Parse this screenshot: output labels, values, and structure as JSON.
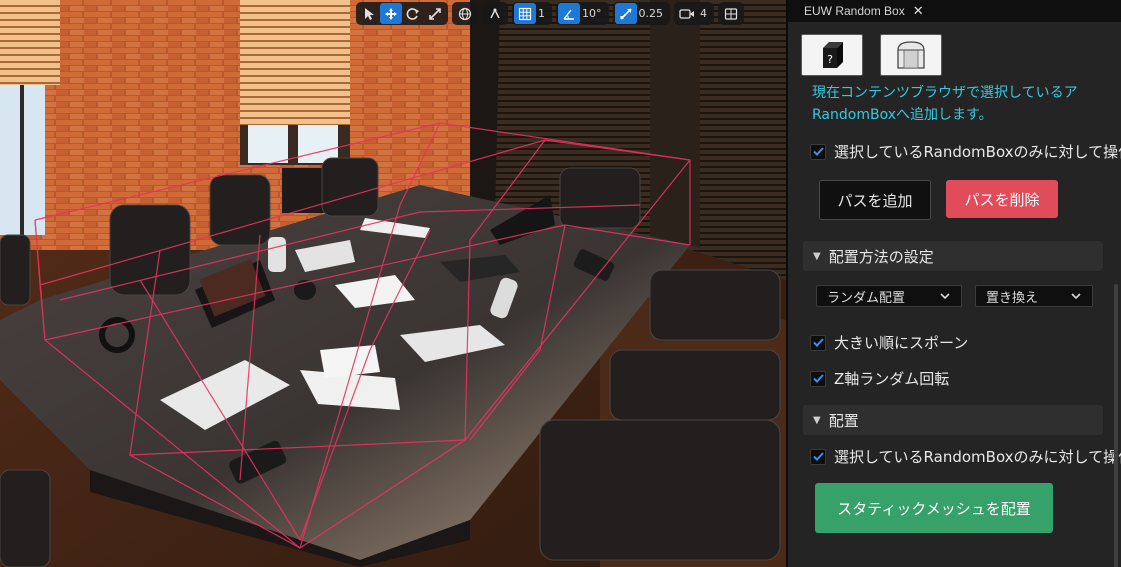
{
  "viewport": {
    "toolbar": {
      "grid_snap_value": "1",
      "rotation_snap_value": "10°",
      "scale_snap_value": "0.25",
      "camera_speed_value": "4"
    }
  },
  "panel": {
    "tab_title": "EUW Random Box",
    "tab_close": "✕",
    "description_line1": "現在コンテンツブラウザで選択しているア",
    "description_line2": "RandomBoxへ追加します。",
    "selected_only_label_1": "選択しているRandomBoxのみに対して操作",
    "add_path_button": "パスを追加",
    "remove_path_button": "パスを削除",
    "placement_method_section": "配置方法の設定",
    "placement_mode_dropdown": "ランダム配置",
    "replace_dropdown": "置き換え",
    "spawn_by_size_label": "大きい順にスポーン",
    "random_z_rotation_label": "Z軸ランダム回転",
    "placement_section": "配置",
    "selected_only_label_2": "選択しているRandomBoxのみに対して操作",
    "place_static_mesh_button": "スタティックメッシュを配置",
    "selected_only_checked": true,
    "spawn_by_size_checked": true,
    "random_z_rotation_checked": true,
    "selected_only_2_checked": true
  },
  "colors": {
    "accent_blue": "#1e78d6",
    "description_cyan": "#35c9e0",
    "remove_red": "#e04c5a",
    "place_green": "#36a26a",
    "bounds_pink": "#e8325f"
  }
}
